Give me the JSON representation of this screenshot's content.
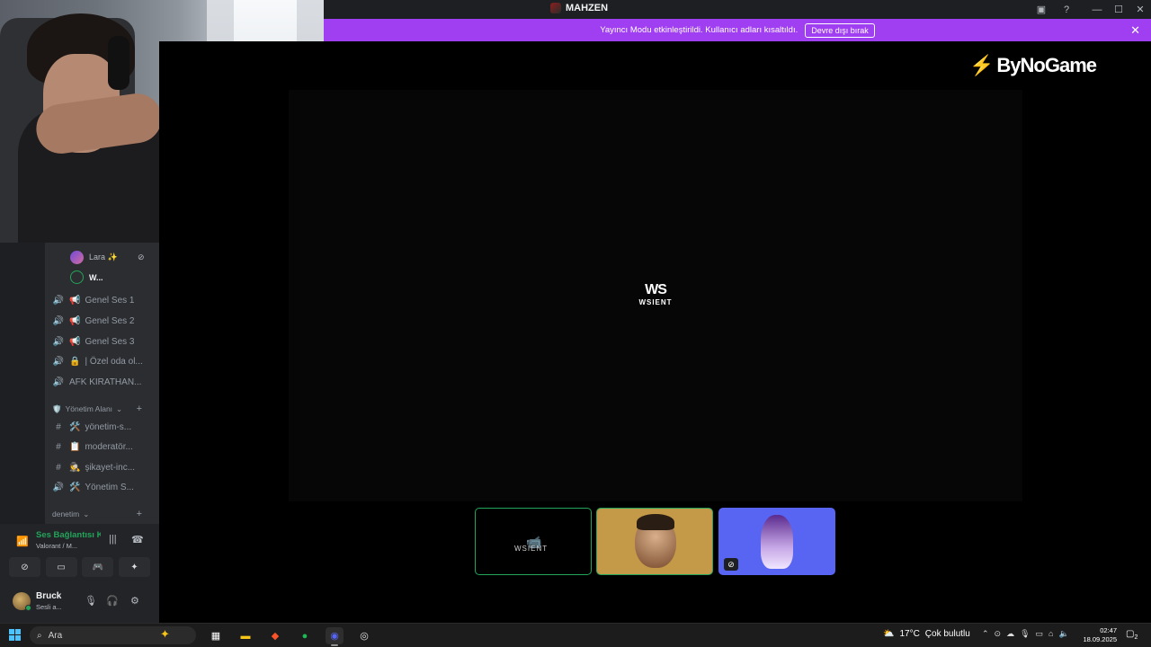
{
  "window": {
    "title": "MAHZEN",
    "controls": {
      "minimize": "—",
      "maximize": "☐",
      "close": "✕"
    }
  },
  "banner": {
    "text": "Yayıncı Modu etkinleştirildi. Kullanıcı adları kısaltıldı.",
    "button": "Devre dışı bırak"
  },
  "brand": {
    "name": "ByNoGame"
  },
  "center_logo": {
    "mark": "WS",
    "text": "WSIENT"
  },
  "sidebar": {
    "voice_users": [
      {
        "name": "Lara ✨",
        "icon": "stream-off-icon"
      },
      {
        "name": "W..."
      }
    ],
    "channels": [
      {
        "label": "Genel Ses 1",
        "icon": "speaker-icon",
        "emoji": "📢"
      },
      {
        "label": "Genel Ses 2",
        "icon": "speaker-icon",
        "emoji": "📢"
      },
      {
        "label": "Genel Ses 3",
        "icon": "speaker-icon",
        "emoji": "📢"
      },
      {
        "label": "| Özel oda ol...",
        "icon": "speaker-icon",
        "emoji": "🔒"
      },
      {
        "label": "AFK KIRATHAN...",
        "icon": "speaker-icon"
      }
    ],
    "category_admin": {
      "label": "Yönetim Alanı",
      "emoji": "🛡️"
    },
    "admin_channels": [
      {
        "label": "yönetim-s...",
        "icon": "hashtag-icon",
        "emoji": "🛠️"
      },
      {
        "label": "moderatör...",
        "icon": "hashtag-icon",
        "emoji": "📋"
      },
      {
        "label": "şikayet-inc...",
        "icon": "hashtag-icon",
        "emoji": "🕵️"
      },
      {
        "label": "Yönetim S...",
        "icon": "speaker-icon",
        "emoji": "🛠️"
      }
    ],
    "category_audit": {
      "label": "denetim"
    }
  },
  "voice_panel": {
    "status": "Ses Bağlantısı Kuruldu",
    "channel": "Valorant / M..."
  },
  "user": {
    "name": "Bruck",
    "status": "Sesli a..."
  },
  "tiles": [
    {
      "label": "WSIENT"
    },
    {
      "label": ""
    },
    {
      "label": ""
    }
  ],
  "taskbar": {
    "search": "Ara",
    "weather_temp": "17°C",
    "weather_desc": "Çok bulutlu",
    "time": "02:47",
    "date": "18.09.2025",
    "notifications": "2"
  }
}
